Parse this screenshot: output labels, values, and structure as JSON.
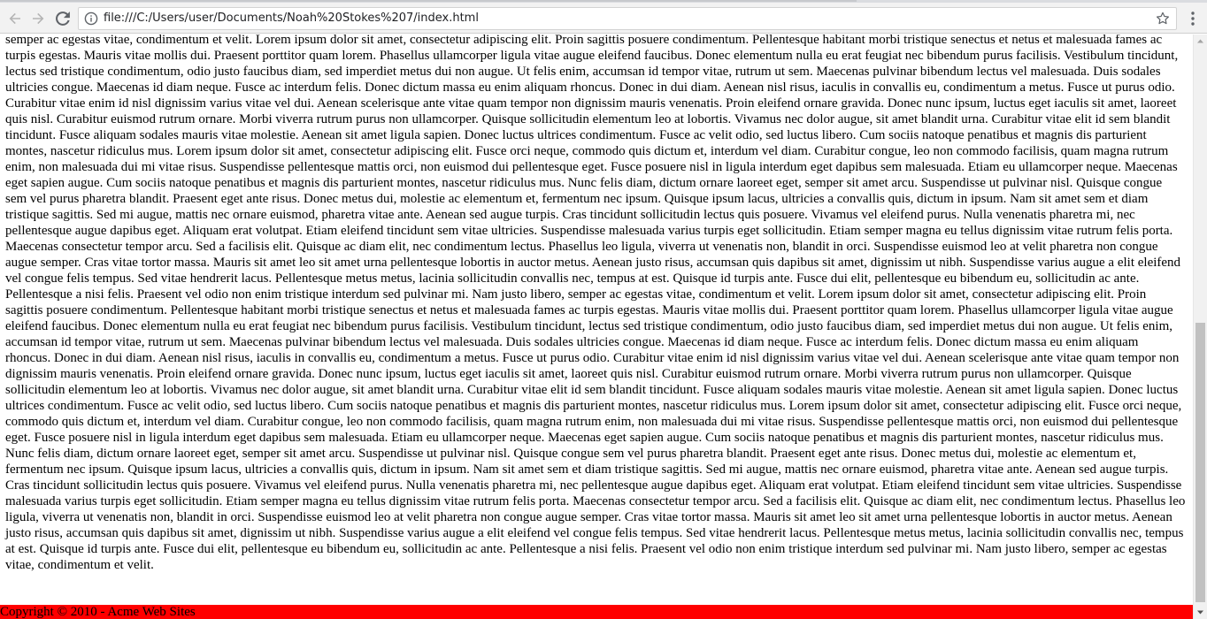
{
  "browser": {
    "url": "file:///C:/Users/user/Documents/Noah%20Stokes%207/index.html",
    "icons": {
      "back": "arrow-left-icon",
      "forward": "arrow-right-icon",
      "reload": "reload-icon",
      "info": "info-circle-icon",
      "bookmark": "star-icon",
      "menu": "kebab-menu-icon"
    }
  },
  "page": {
    "body_text": "semper ac egestas vitae, condimentum et velit. Lorem ipsum dolor sit amet, consectetur adipiscing elit. Proin sagittis posuere condimentum. Pellentesque habitant morbi tristique senectus et netus et malesuada fames ac turpis egestas. Mauris vitae mollis dui. Praesent porttitor quam lorem. Phasellus ullamcorper ligula vitae augue eleifend faucibus. Donec elementum nulla eu erat feugiat nec bibendum purus facilisis. Vestibulum tincidunt, lectus sed tristique condimentum, odio justo faucibus diam, sed imperdiet metus dui non augue. Ut felis enim, accumsan id tempor vitae, rutrum ut sem. Maecenas pulvinar bibendum lectus vel malesuada. Duis sodales ultricies congue. Maecenas id diam neque. Fusce ac interdum felis. Donec dictum massa eu enim aliquam rhoncus. Donec in dui diam. Aenean nisl risus, iaculis in convallis eu, condimentum a metus. Fusce ut purus odio. Curabitur vitae enim id nisl dignissim varius vitae vel dui. Aenean scelerisque ante vitae quam tempor non dignissim mauris venenatis. Proin eleifend ornare gravida. Donec nunc ipsum, luctus eget iaculis sit amet, laoreet quis nisl. Curabitur euismod rutrum ornare. Morbi viverra rutrum purus non ullamcorper. Quisque sollicitudin elementum leo at lobortis. Vivamus nec dolor augue, sit amet blandit urna. Curabitur vitae elit id sem blandit tincidunt. Fusce aliquam sodales mauris vitae molestie. Aenean sit amet ligula sapien. Donec luctus ultrices condimentum. Fusce ac velit odio, sed luctus libero. Cum sociis natoque penatibus et magnis dis parturient montes, nascetur ridiculus mus. Lorem ipsum dolor sit amet, consectetur adipiscing elit. Fusce orci neque, commodo quis dictum et, interdum vel diam. Curabitur congue, leo non commodo facilisis, quam magna rutrum enim, non malesuada dui mi vitae risus. Suspendisse pellentesque mattis orci, non euismod dui pellentesque eget. Fusce posuere nisl in ligula interdum eget dapibus sem malesuada. Etiam eu ullamcorper neque. Maecenas eget sapien augue. Cum sociis natoque penatibus et magnis dis parturient montes, nascetur ridiculus mus. Nunc felis diam, dictum ornare laoreet eget, semper sit amet arcu. Suspendisse ut pulvinar nisl. Quisque congue sem vel purus pharetra blandit. Praesent eget ante risus. Donec metus dui, molestie ac elementum et, fermentum nec ipsum. Quisque ipsum lacus, ultricies a convallis quis, dictum in ipsum. Nam sit amet sem et diam tristique sagittis. Sed mi augue, mattis nec ornare euismod, pharetra vitae ante. Aenean sed augue turpis. Cras tincidunt sollicitudin lectus quis posuere. Vivamus vel eleifend purus. Nulla venenatis pharetra mi, nec pellentesque augue dapibus eget. Aliquam erat volutpat. Etiam eleifend tincidunt sem vitae ultricies. Suspendisse malesuada varius turpis eget sollicitudin. Etiam semper magna eu tellus dignissim vitae rutrum felis porta. Maecenas consectetur tempor arcu. Sed a facilisis elit. Quisque ac diam elit, nec condimentum lectus. Phasellus leo ligula, viverra ut venenatis non, blandit in orci. Suspendisse euismod leo at velit pharetra non congue augue semper. Cras vitae tortor massa. Mauris sit amet leo sit amet urna pellentesque lobortis in auctor metus. Aenean justo risus, accumsan quis dapibus sit amet, dignissim ut nibh. Suspendisse varius augue a elit eleifend vel congue felis tempus. Sed vitae hendrerit lacus. Pellentesque metus metus, lacinia sollicitudin convallis nec, tempus at est. Quisque id turpis ante. Fusce dui elit, pellentesque eu bibendum eu, sollicitudin ac ante. Pellentesque a nisi felis. Praesent vel odio non enim tristique interdum sed pulvinar mi. Nam justo libero, semper ac egestas vitae, condimentum et velit. Lorem ipsum dolor sit amet, consectetur adipiscing elit. Proin sagittis posuere condimentum. Pellentesque habitant morbi tristique senectus et netus et malesuada fames ac turpis egestas. Mauris vitae mollis dui. Praesent porttitor quam lorem. Phasellus ullamcorper ligula vitae augue eleifend faucibus. Donec elementum nulla eu erat feugiat nec bibendum purus facilisis. Vestibulum tincidunt, lectus sed tristique condimentum, odio justo faucibus diam, sed imperdiet metus dui non augue. Ut felis enim, accumsan id tempor vitae, rutrum ut sem. Maecenas pulvinar bibendum lectus vel malesuada. Duis sodales ultricies congue. Maecenas id diam neque. Fusce ac interdum felis. Donec dictum massa eu enim aliquam rhoncus. Donec in dui diam. Aenean nisl risus, iaculis in convallis eu, condimentum a metus. Fusce ut purus odio. Curabitur vitae enim id nisl dignissim varius vitae vel dui. Aenean scelerisque ante vitae quam tempor non dignissim mauris venenatis. Proin eleifend ornare gravida. Donec nunc ipsum, luctus eget iaculis sit amet, laoreet quis nisl. Curabitur euismod rutrum ornare. Morbi viverra rutrum purus non ullamcorper. Quisque sollicitudin elementum leo at lobortis. Vivamus nec dolor augue, sit amet blandit urna. Curabitur vitae elit id sem blandit tincidunt. Fusce aliquam sodales mauris vitae molestie. Aenean sit amet ligula sapien. Donec luctus ultrices condimentum. Fusce ac velit odio, sed luctus libero. Cum sociis natoque penatibus et magnis dis parturient montes, nascetur ridiculus mus. Lorem ipsum dolor sit amet, consectetur adipiscing elit. Fusce orci neque, commodo quis dictum et, interdum vel diam. Curabitur congue, leo non commodo facilisis, quam magna rutrum enim, non malesuada dui mi vitae risus. Suspendisse pellentesque mattis orci, non euismod dui pellentesque eget. Fusce posuere nisl in ligula interdum eget dapibus sem malesuada. Etiam eu ullamcorper neque. Maecenas eget sapien augue. Cum sociis natoque penatibus et magnis dis parturient montes, nascetur ridiculus mus. Nunc felis diam, dictum ornare laoreet eget, semper sit amet arcu. Suspendisse ut pulvinar nisl. Quisque congue sem vel purus pharetra blandit. Praesent eget ante risus. Donec metus dui, molestie ac elementum et, fermentum nec ipsum. Quisque ipsum lacus, ultricies a convallis quis, dictum in ipsum. Nam sit amet sem et diam tristique sagittis. Sed mi augue, mattis nec ornare euismod, pharetra vitae ante. Aenean sed augue turpis. Cras tincidunt sollicitudin lectus quis posuere. Vivamus vel eleifend purus. Nulla venenatis pharetra mi, nec pellentesque augue dapibus eget. Aliquam erat volutpat. Etiam eleifend tincidunt sem vitae ultricies. Suspendisse malesuada varius turpis eget sollicitudin. Etiam semper magna eu tellus dignissim vitae rutrum felis porta. Maecenas consectetur tempor arcu. Sed a facilisis elit. Quisque ac diam elit, nec condimentum lectus. Phasellus leo ligula, viverra ut venenatis non, blandit in orci. Suspendisse euismod leo at velit pharetra non congue augue semper. Cras vitae tortor massa. Mauris sit amet leo sit amet urna pellentesque lobortis in auctor metus. Aenean justo risus, accumsan quis dapibus sit amet, dignissim ut nibh. Suspendisse varius augue a elit eleifend vel congue felis tempus. Sed vitae hendrerit lacus. Pellentesque metus metus, lacinia sollicitudin convallis nec, tempus at est. Quisque id turpis ante. Fusce dui elit, pellentesque eu bibendum eu, sollicitudin ac ante. Pellentesque a nisi felis. Praesent vel odio non enim tristique interdum sed pulvinar mi. Nam justo libero, semper ac egestas vitae, condimentum et velit.",
    "footer_text": "Copyright © 2010 - Acme Web Sites",
    "footer_color": "#ff0000"
  }
}
